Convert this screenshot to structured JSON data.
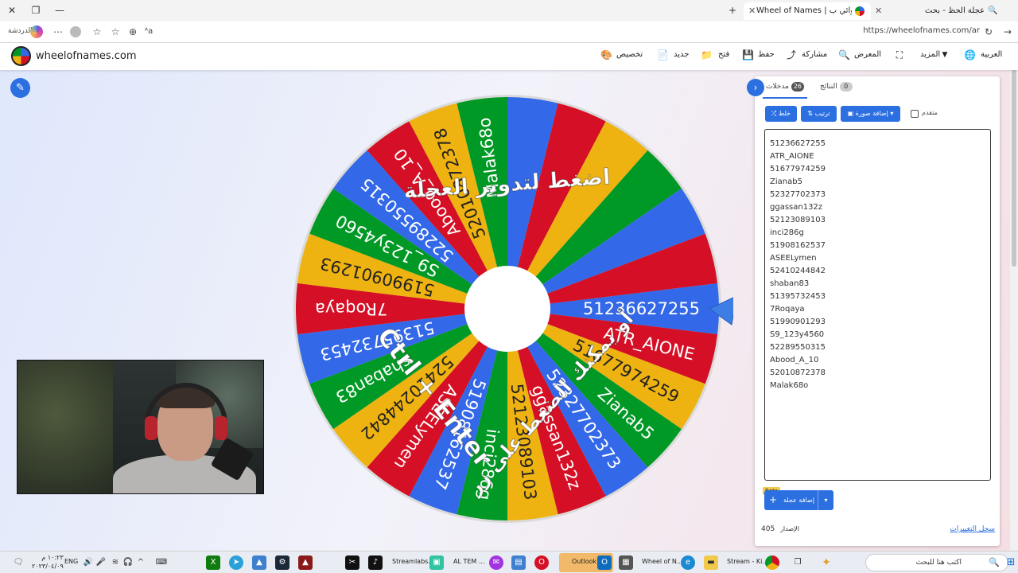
{
  "browser": {
    "tabs": [
      {
        "title": "عجلة الحظ - بحث"
      },
      {
        "title": "Wheel of Names | الاسم العشوائي ب"
      }
    ],
    "url": "https://wheelofnames.com/ar",
    "translate_label": "الدردشة"
  },
  "site": {
    "logo": "wheelofnames.com",
    "nav": {
      "customize": "تخصيص",
      "new": "جديد",
      "open": "فتح",
      "save": "حفظ",
      "share": "مشاركة",
      "gallery": "المعرض",
      "more": "المزيد",
      "language": "العربية"
    }
  },
  "wheel": {
    "overlay_lines": [
      "اضغط لتدوير العجلة",
      "أو يمكنك الضغط على زر",
      "Ctrl + Enter"
    ],
    "colors": [
      "#3369e8",
      "#d50f25",
      "#eeb211",
      "#009925"
    ],
    "slice_labels": [
      "51236627255",
      "ATR_AIONE",
      "51677974259",
      "Zianab5",
      "52327702373",
      "ggassan132z",
      "52123089103",
      "inci286g",
      "51908162537",
      "ASEELymen",
      "52410244842",
      "shaban83",
      "51395732453",
      "7Roqaya",
      "51990901293",
      "S9_123y4560",
      "52289550315",
      "Abood_A_10",
      "52010872378",
      "Malak68o"
    ]
  },
  "panel": {
    "tab_entries": "مدخلات",
    "entries_count": "26",
    "tab_results": "النتائج",
    "results_count": "0",
    "shuffle": "خلط",
    "sort": "ترتيب",
    "add_image": "إضافة صورة",
    "advanced": "متقدم",
    "entries": [
      "51236627255",
      "ATR_AIONE",
      "51677974259",
      "Zianab5",
      "52327702373",
      "ggassan132z",
      "52123089103",
      "inci286g",
      "51908162537",
      "ASEELymen",
      "52410244842",
      "shaban83",
      "51395732453",
      "7Roqaya",
      "51990901293",
      "S9_123y4560",
      "52289550315",
      "Abood_A_10",
      "52010872378",
      "Malak68o"
    ],
    "beta": "Beta",
    "add_wheel": "إضافة عجلة",
    "version_label": "الإصدار",
    "version": "405",
    "changelog": "سجل التغييرات"
  },
  "taskbar": {
    "time": "١٠:٢٣ م",
    "date": "٢٠٢٣/٠٤/٠٩",
    "lang": "ENG",
    "apps": {
      "streamlabs": "Streamlabs...",
      "al_tem": "AL TEM ...",
      "outlook": "Outlook",
      "wheel": "Wheel of N...",
      "stream": "Stream - Ki..."
    },
    "search_placeholder": "اكتب هنا للبحث"
  }
}
